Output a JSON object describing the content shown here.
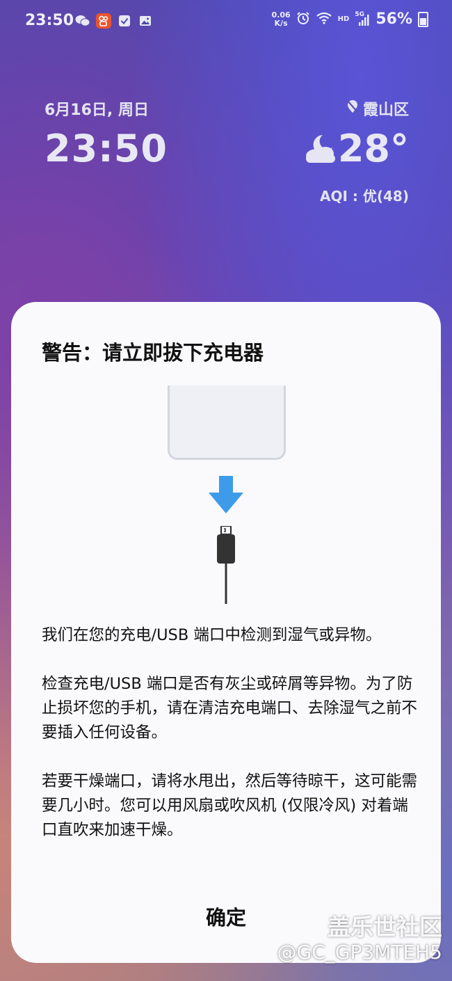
{
  "status_bar": {
    "time": "23:50",
    "app_icons": [
      "wechat-icon",
      "kuaishou-icon",
      "checklist-icon",
      "gallery-icon"
    ],
    "net_speed_value": "0.06",
    "net_speed_unit": "K/s",
    "hd_label": "HD",
    "signal_label": "5G",
    "battery_percent": "56%"
  },
  "lock_screen": {
    "date": "6月16日, 周日",
    "time": "23:50",
    "location": "霞山区",
    "temperature": "28°",
    "aqi": "AQI : 优(48)"
  },
  "dialog": {
    "title": "警告：请立即拔下充电器",
    "paragraphs": [
      "我们在您的充电/USB 端口中检测到湿气或异物。",
      "检查充电/USB 端口是否有灰尘或碎屑等异物。为了防止损坏您的手机，请在清洁充电端口、去除湿气之前不要插入任何设备。",
      "若要干燥端口，请将水甩出，然后等待晾干，这可能需要几小时。您可以用风扇或吹风机 (仅限冷风) 对着端口直吹来加速干燥。"
    ],
    "confirm_label": "确定"
  },
  "watermark": {
    "community": "盖乐世社区",
    "user": "@GC_GP3MTEH5"
  },
  "colors": {
    "arrow": "#3d9be9",
    "cable": "#333333"
  }
}
